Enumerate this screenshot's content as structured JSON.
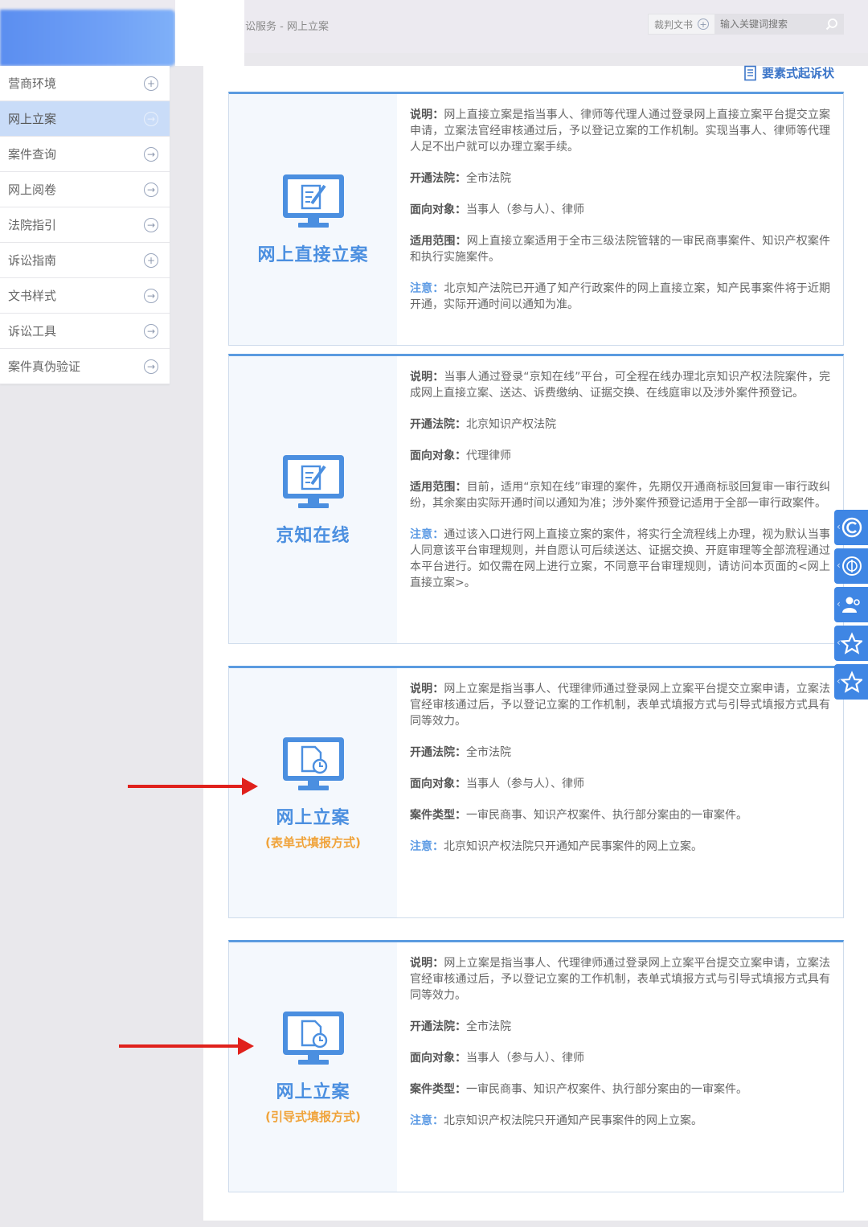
{
  "header": {
    "breadcrumb": "讼服务 - 网上立案",
    "search_type": "裁判文书",
    "search_placeholder": "输入关键词搜索"
  },
  "sidebar": {
    "items": [
      {
        "label": "营商环境",
        "icon": "plus-circle-icon",
        "active": false
      },
      {
        "label": "网上立案",
        "icon": "arrow-circle-icon",
        "active": true
      },
      {
        "label": "案件查询",
        "icon": "arrow-circle-icon",
        "active": false
      },
      {
        "label": "网上阅卷",
        "icon": "arrow-circle-icon",
        "active": false
      },
      {
        "label": "法院指引",
        "icon": "arrow-circle-icon",
        "active": false
      },
      {
        "label": "诉讼指南",
        "icon": "plus-circle-icon",
        "active": false
      },
      {
        "label": "文书样式",
        "icon": "arrow-circle-icon",
        "active": false
      },
      {
        "label": "诉讼工具",
        "icon": "arrow-circle-icon",
        "active": false
      },
      {
        "label": "案件真伪验证",
        "icon": "arrow-circle-icon",
        "active": false
      }
    ]
  },
  "main": {
    "complaint_link": "要素式起诉状",
    "cards": [
      {
        "title": "网上直接立案",
        "subtitle": "",
        "icon": "edit-document-icon",
        "paras": [
          {
            "label": "说明：",
            "text": "网上直接立案是指当事人、律师等代理人通过登录网上直接立案平台提交立案申请，立案法官经审核通过后，予以登记立案的工作机制。实现当事人、律师等代理人足不出户就可以办理立案手续。"
          },
          {
            "label": "开通法院：",
            "text": "全市法院"
          },
          {
            "label": "面向对象：",
            "text": "当事人（参与人）、律师"
          },
          {
            "label": "适用范围：",
            "text": "网上直接立案适用于全市三级法院管辖的一审民商事案件、知识产权案件和执行实施案件。"
          },
          {
            "label": "注意：",
            "text": "北京知产法院已开通了知产行政案件的网上直接立案，知产民事案件将于近期开通，实际开通时间以通知为准。"
          }
        ]
      },
      {
        "title": "京知在线",
        "subtitle": "",
        "icon": "edit-document-icon",
        "paras": [
          {
            "label": "说明：",
            "text": "当事人通过登录“京知在线”平台，可全程在线办理北京知识产权法院案件，完成网上直接立案、送达、诉费缴纳、证据交换、在线庭审以及涉外案件预登记。"
          },
          {
            "label": "开通法院：",
            "text": "北京知识产权法院"
          },
          {
            "label": "面向对象：",
            "text": "代理律师"
          },
          {
            "label": "适用范围：",
            "text": "目前，适用“京知在线”审理的案件，先期仅开通商标驳回复审一审行政纠纷，其余案由实际开通时间以通知为准；涉外案件预登记适用于全部一审行政案件。"
          },
          {
            "label": "注意：",
            "text": "通过该入口进行网上直接立案的案件，将实行全流程线上办理，视为默认当事人同意该平台审理规则，并自愿认可后续送达、证据交换、开庭审理等全部流程通过本平台进行。如仅需在网上进行立案，不同意平台审理规则，请访问本页面的<网上直接立案>。"
          }
        ]
      },
      {
        "title": "网上立案",
        "subtitle": "(表单式填报方式)",
        "icon": "clock-document-icon",
        "paras": [
          {
            "label": "说明：",
            "text": "网上立案是指当事人、代理律师通过登录网上立案平台提交立案申请，立案法官经审核通过后，予以登记立案的工作机制，表单式填报方式与引导式填报方式具有同等效力。"
          },
          {
            "label": "开通法院：",
            "text": "全市法院"
          },
          {
            "label": "面向对象：",
            "text": "当事人（参与人）、律师"
          },
          {
            "label": "案件类型：",
            "text": "一审民商事、知识产权案件、执行部分案由的一审案件。"
          },
          {
            "label": "注意：",
            "text": "北京知识产权法院只开通知产民事案件的网上立案。"
          }
        ]
      },
      {
        "title": "网上立案",
        "subtitle": "(引导式填报方式)",
        "icon": "clock-document-icon",
        "paras": [
          {
            "label": "说明：",
            "text": "网上立案是指当事人、代理律师通过登录网上立案平台提交立案申请，立案法官经审核通过后，予以登记立案的工作机制，表单式填报方式与引导式填报方式具有同等效力。"
          },
          {
            "label": "开通法院：",
            "text": "全市法院"
          },
          {
            "label": "面向对象：",
            "text": "当事人（参与人）、律师"
          },
          {
            "label": "案件类型：",
            "text": "一审民商事、知识产权案件、执行部分案由的一审案件。"
          },
          {
            "label": "注意：",
            "text": "北京知识产权法院只开通知产民事案件的网上立案。"
          }
        ]
      }
    ]
  },
  "float_toolbar": [
    {
      "icon": "copyright-icon"
    },
    {
      "icon": "court-emblem-icon"
    },
    {
      "icon": "people-icon"
    },
    {
      "icon": "star-icon"
    },
    {
      "icon": "star-icon"
    }
  ],
  "colors": {
    "accent": "#4b8fe0",
    "subtitle": "#f0a33a",
    "arrow": "#e0211c",
    "active_bg": "#c9dcf8"
  }
}
